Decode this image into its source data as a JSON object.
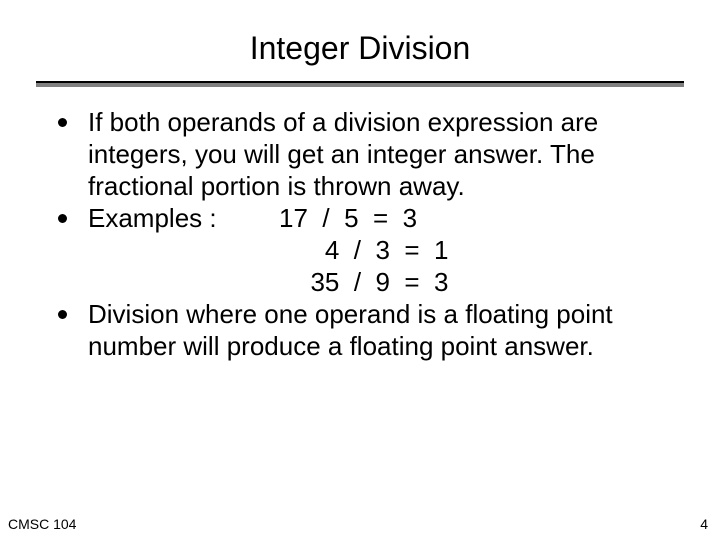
{
  "title": "Integer Division",
  "bullets": {
    "b1": "If both operands of a division expression are integers, you will get an integer answer.   The fractional portion is thrown away.",
    "b2_label": "Examples :",
    "b2_ex1": "  17  /  5  =  3",
    "b2_ex2": "    4  /  3  =  1",
    "b2_ex3": "  35  /  9  =  3",
    "b3": "Division where one operand is a floating point number will produce a floating point answer."
  },
  "footer": {
    "left": "CMSC 104",
    "right": "4"
  }
}
